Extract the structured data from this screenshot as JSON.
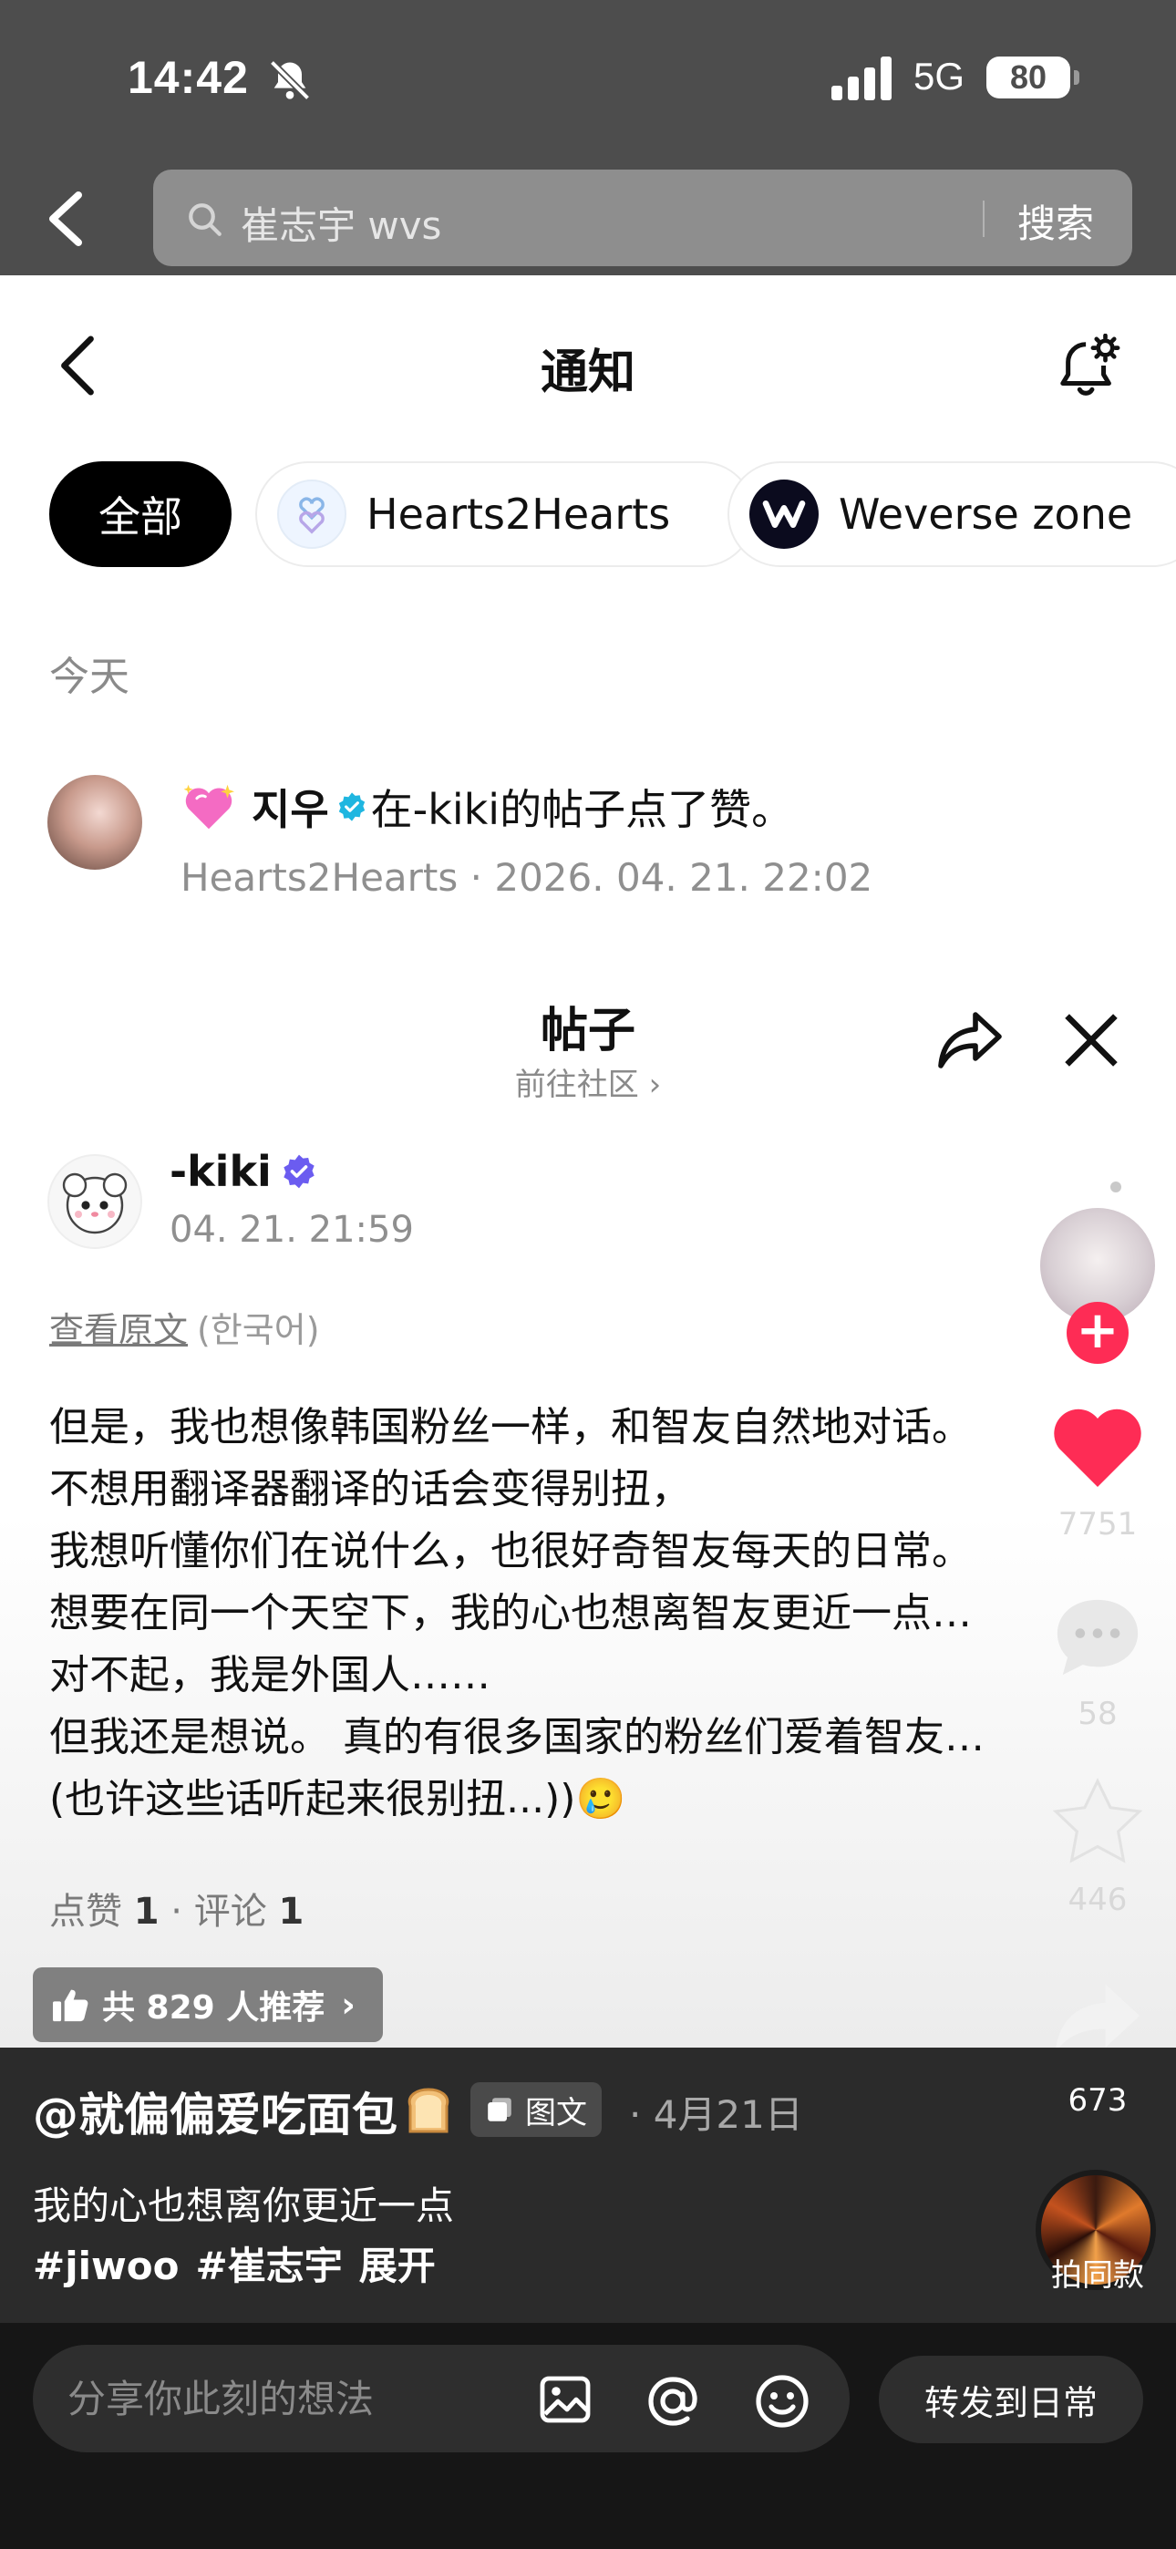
{
  "status_bar": {
    "time": "14:42",
    "network": "5G",
    "battery": "80"
  },
  "search": {
    "query": "崔志宇 wvs",
    "button_label": "搜索"
  },
  "notifications": {
    "title": "通知",
    "filters": [
      {
        "label": "全部",
        "selected": true
      },
      {
        "label": "Hearts2Hearts",
        "selected": false
      },
      {
        "label": "Weverse zone",
        "selected": false
      }
    ],
    "section_label": "今天",
    "item": {
      "user": "지우",
      "action": "在-kiki的帖子点了赞。",
      "source": "Hearts2Hearts",
      "separator": "·",
      "time": "2026. 04. 21. 22:02"
    }
  },
  "post": {
    "title": "帖子",
    "community_link": "前往社区 ›",
    "author": "-kiki",
    "time": "04. 21. 21:59",
    "translate_link": "查看原文",
    "original_language": "(한국어)",
    "body_lines": [
      "但是，我也想像韩国粉丝一样，和智友自然地对话。",
      "不想用翻译器翻译的话会变得别扭，",
      "我想听懂你们在说什么，也很好奇智友每天的日常。",
      "想要在同一个天空下，我的心也想离智友更近一点…",
      "对不起，我是外国人……",
      "但我还是想说。 真的有很多国家的粉丝们爱着智友…",
      "(也许这些话听起来很别扭...))🥲"
    ],
    "likes_label": "点赞",
    "likes_count": "1",
    "stats_separator": "·",
    "comments_label": "评论",
    "comments_count": "1",
    "recommend_text": "共 829 人推荐"
  },
  "rail": {
    "likes": "7751",
    "comments": "58",
    "favorites": "446",
    "forwards": "673"
  },
  "video_info": {
    "creator": "@就偏偏爱吃面包",
    "type_badge": "图文",
    "date": "· 4月21日",
    "caption": "我的心也想离你更近一点",
    "hashtags": [
      "#jiwoo",
      "#崔志宇"
    ],
    "expand": "展开",
    "same_style": "拍同款"
  },
  "comment_bar": {
    "placeholder": "分享你此刻的想法",
    "repost_label": "转发到日常"
  },
  "colors": {
    "accent_red": "#fe2c55",
    "verify_blue": "#1fb6e0",
    "verify_purple": "#6b5cf0"
  }
}
